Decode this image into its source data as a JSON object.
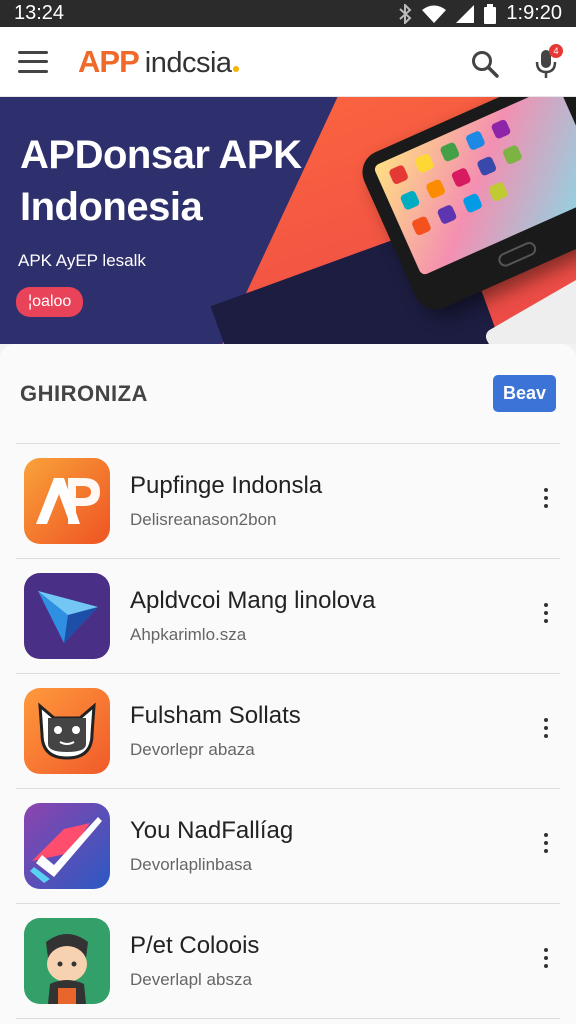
{
  "status_bar": {
    "left_time": "13:24",
    "right_time": "1:9:20"
  },
  "app_bar": {
    "logo_app": "APP",
    "logo_brand": "indcsia",
    "notification_count": "4"
  },
  "banner": {
    "title_line1": "APDonsar APK",
    "title_line2": "Indonesia",
    "subtitle": "APK AyEP lesalk",
    "button_label": "¦oaloo"
  },
  "section": {
    "title": "GHIRONIZA",
    "button_label": "Beav"
  },
  "apps": [
    {
      "name": "Pupfinge Indonsla",
      "developer": "Delisreanason2bon"
    },
    {
      "name": "Apldvcoi Mang linolova",
      "developer": "Ahpkarimlo.sza"
    },
    {
      "name": "Fulsham Sollats",
      "developer": "Devorlepr abaza"
    },
    {
      "name": "You NadFallíag",
      "developer": "Devorlaplinbasa"
    },
    {
      "name": "P/et Coloois",
      "developer": "Deverlapl absza"
    }
  ],
  "icons": {
    "menu": "hamburger-icon",
    "search": "search-icon",
    "mic": "microphone-icon",
    "bluetooth": "bluetooth-icon",
    "wifi": "wifi-icon",
    "signal": "signal-icon",
    "battery": "battery-icon"
  },
  "colors": {
    "accent": "#3b73d6",
    "banner_bg": "#2e2f6d",
    "pill": "#e94359",
    "logo_orange": "#ef6a2a"
  }
}
